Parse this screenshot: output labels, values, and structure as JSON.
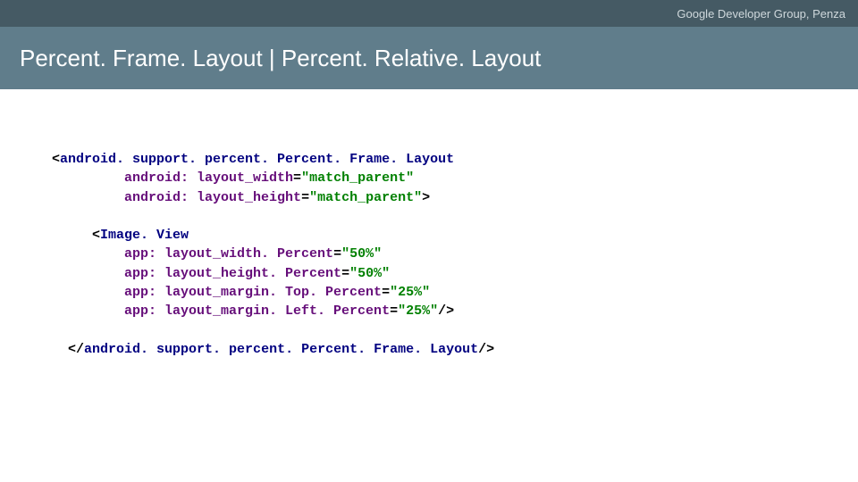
{
  "header": {
    "org": "Google Developer Group, Penza",
    "title": "Percent. Frame. Layout | Percent. Relative. Layout"
  },
  "code": {
    "open_bracket": "<",
    "close_bracket": ">",
    "slash_close": "/>",
    "eq": "=",
    "quote": "\"",
    "outer_tag": "android. support. percent. Percent. Frame. Layout",
    "outer_attrs": [
      {
        "name": "android: layout_width",
        "value": "match_parent"
      },
      {
        "name": "android: layout_height",
        "value": "match_parent"
      }
    ],
    "inner_tag": "Image. View",
    "inner_attrs": [
      {
        "name": "app: layout_width. Percent",
        "value": "50%"
      },
      {
        "name": "app: layout_height. Percent",
        "value": "50%"
      },
      {
        "name": "app: layout_margin. Top. Percent",
        "value": "25%"
      },
      {
        "name": "app: layout_margin. Left. Percent",
        "value": "25%"
      }
    ],
    "close_outer_prefix": "</",
    "close_outer_tag": "android. support. percent. Percent. Frame. Layout"
  }
}
